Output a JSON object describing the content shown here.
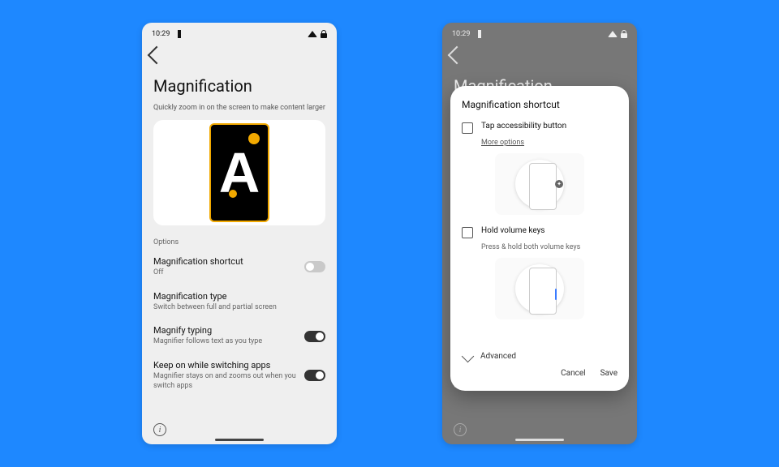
{
  "status": {
    "time": "10:29"
  },
  "page": {
    "title": "Magnification",
    "description": "Quickly zoom in on the screen to make content larger",
    "options_header": "Options"
  },
  "rows": {
    "shortcut": {
      "title": "Magnification shortcut",
      "sub": "Off",
      "on": false
    },
    "type": {
      "title": "Magnification type",
      "sub": "Switch between full and partial screen"
    },
    "typing": {
      "title": "Magnify typing",
      "sub": "Magnifier follows text as you type",
      "on": true
    },
    "keep": {
      "title": "Keep on while switching apps",
      "sub": "Magnifier stays on and zooms out when you switch apps",
      "on": true
    }
  },
  "dialog": {
    "title": "Magnification shortcut",
    "opt1": {
      "label": "Tap accessibility button",
      "more": "More options"
    },
    "opt2": {
      "label": "Hold volume keys",
      "sub": "Press & hold both volume keys"
    },
    "advanced": "Advanced",
    "cancel": "Cancel",
    "save": "Save"
  },
  "info_glyph": "i"
}
